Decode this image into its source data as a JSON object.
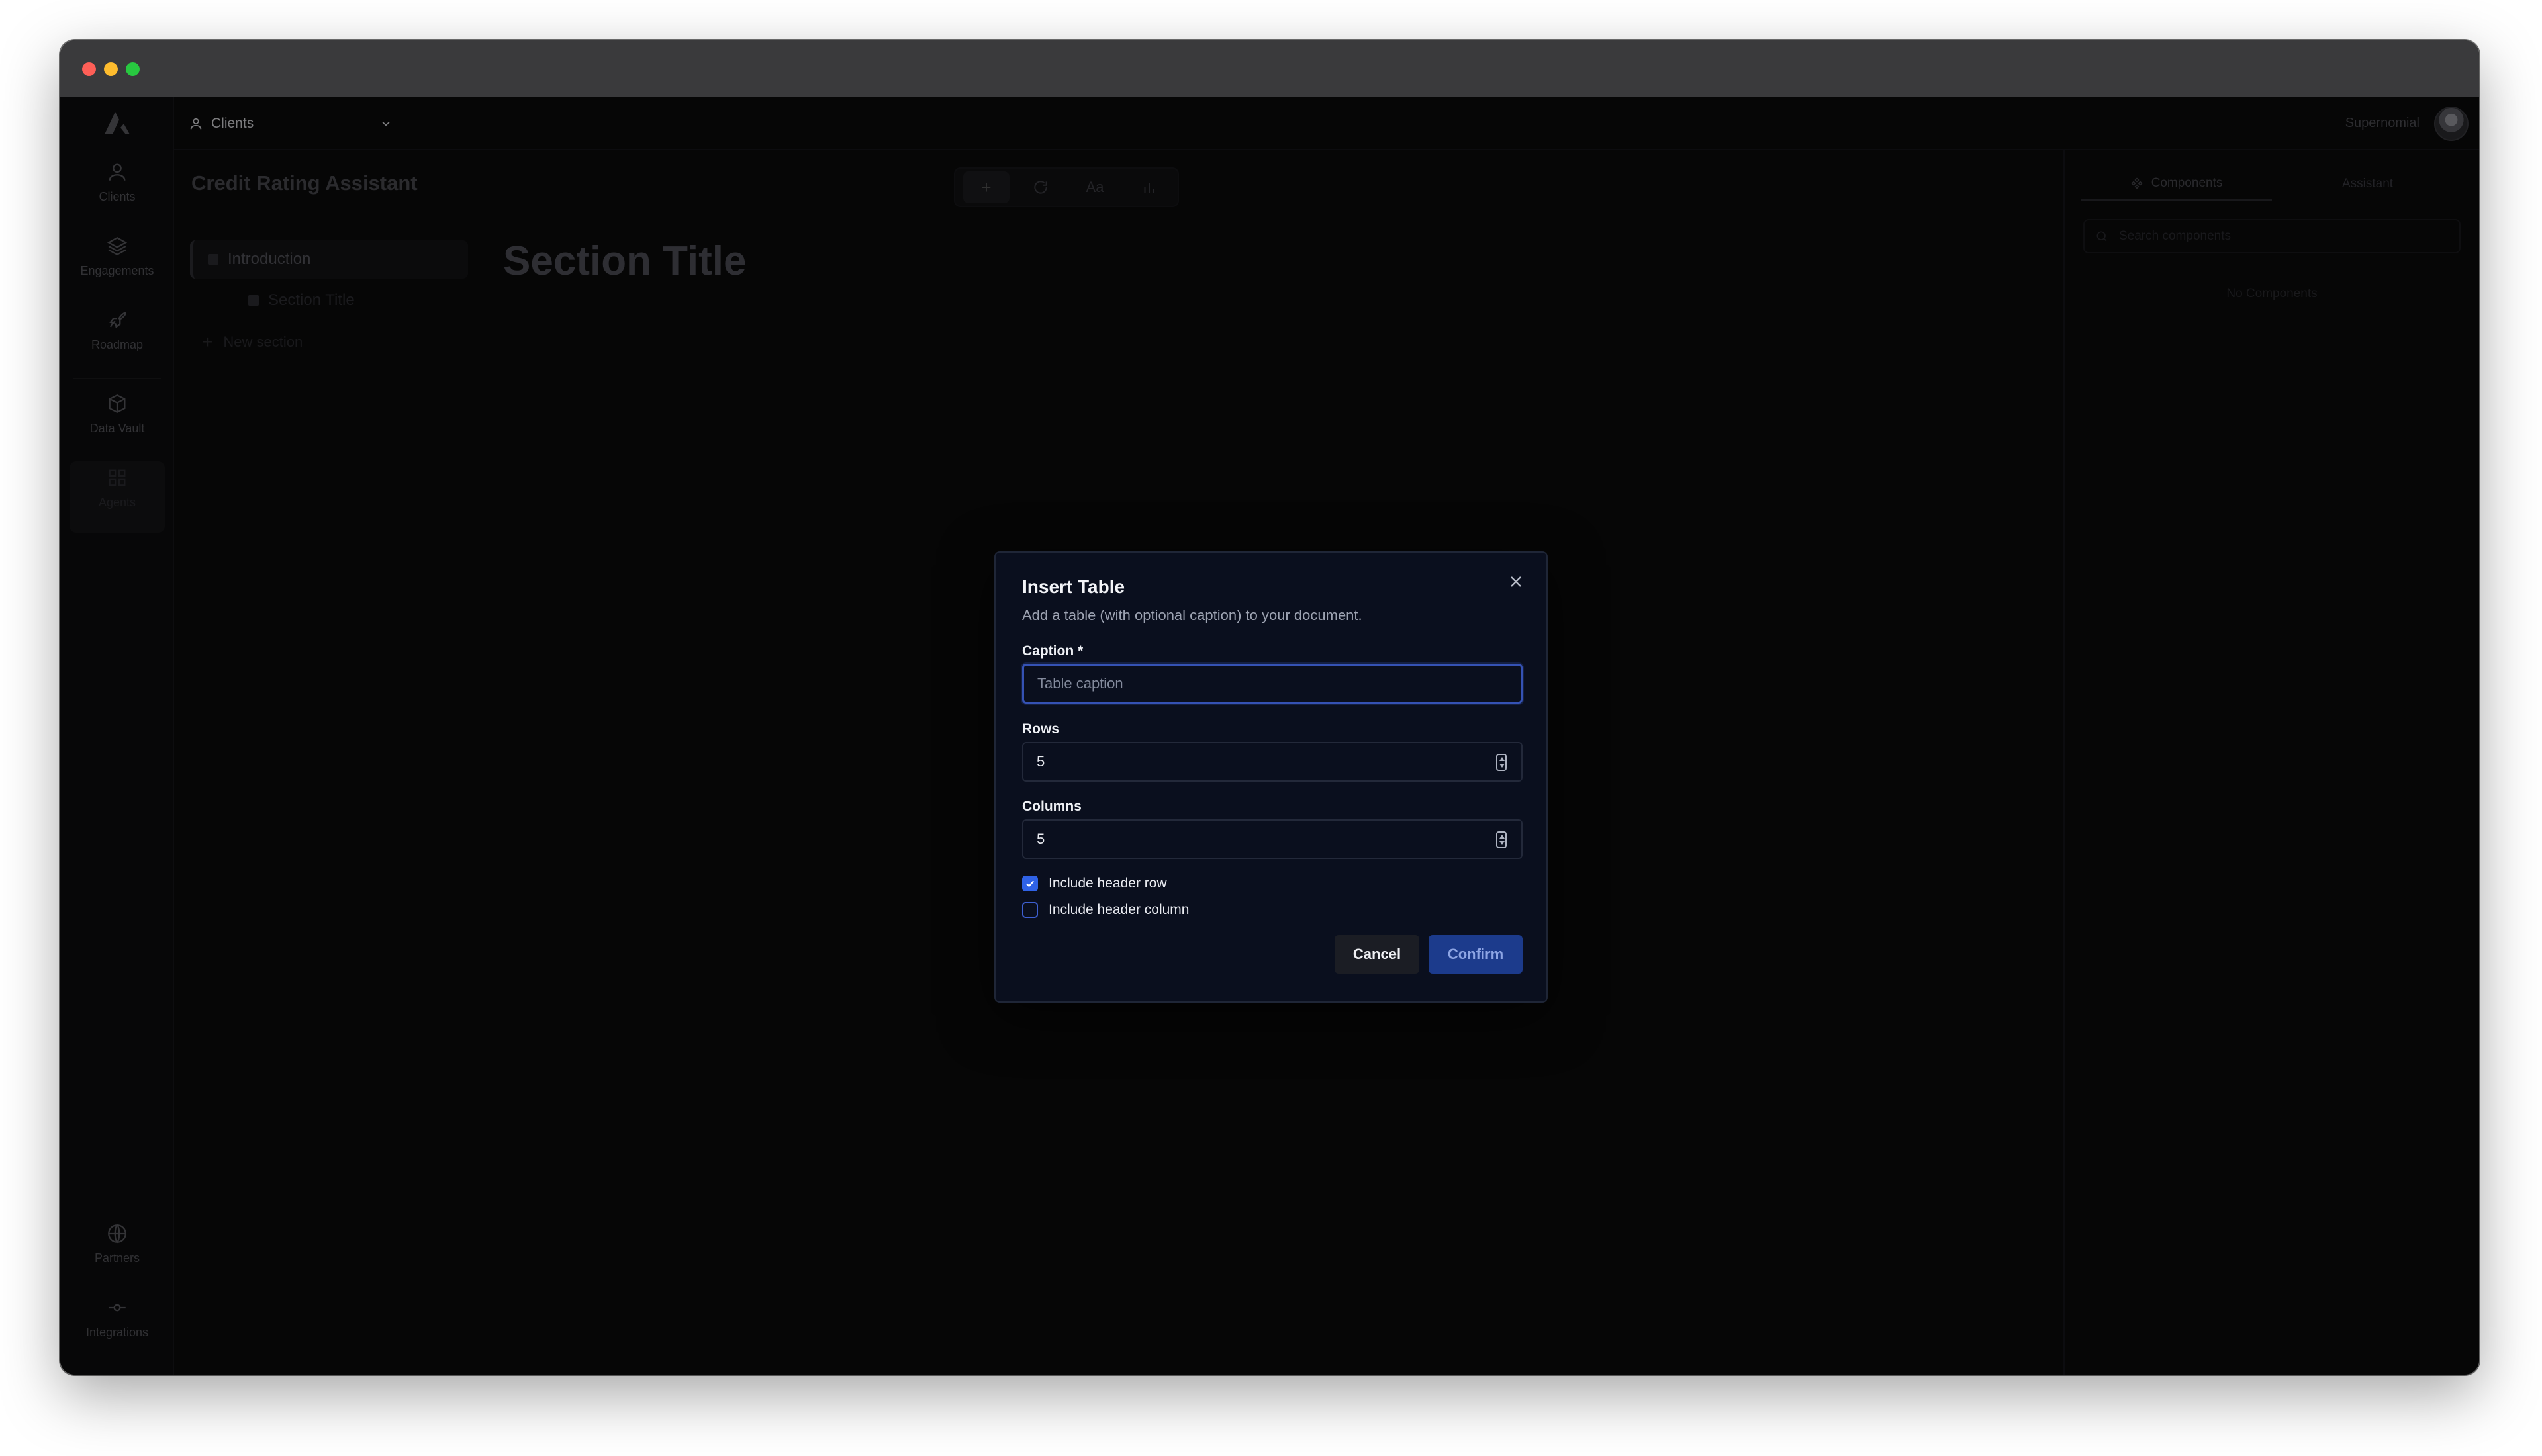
{
  "nav": {
    "clients": "Clients",
    "engagements": "Engagements",
    "roadmap": "Roadmap",
    "data_vault": "Data Vault",
    "agents": "Agents",
    "partners": "Partners",
    "integrations": "Integrations"
  },
  "topbar": {
    "client_selector": "Clients",
    "brand": "Supernomial"
  },
  "document": {
    "title": "Credit Rating Assistant",
    "section_title": "Section Title",
    "outline": [
      "Introduction",
      "Section Title"
    ],
    "new_section": "New section"
  },
  "toolbar": {
    "add": "+",
    "ai_label": "Aa"
  },
  "right_panel": {
    "tab_components": "Components",
    "tab_assistant": "Assistant",
    "search_placeholder": "Search components",
    "empty_state": "No Components"
  },
  "modal": {
    "title": "Insert Table",
    "subtitle": "Add a table (with optional caption) to your document.",
    "caption_label": "Caption *",
    "caption_placeholder": "Table caption",
    "caption_value": "",
    "rows_label": "Rows",
    "rows_value": "5",
    "columns_label": "Columns",
    "columns_value": "5",
    "include_header_row": "Include header row",
    "include_header_row_checked": true,
    "include_header_column": "Include header column",
    "include_header_column_checked": false,
    "cancel": "Cancel",
    "confirm": "Confirm"
  },
  "colors": {
    "accent": "#2f62e6",
    "confirm_bg": "#1c3b8c",
    "modal_bg": "#0a0f1e"
  }
}
